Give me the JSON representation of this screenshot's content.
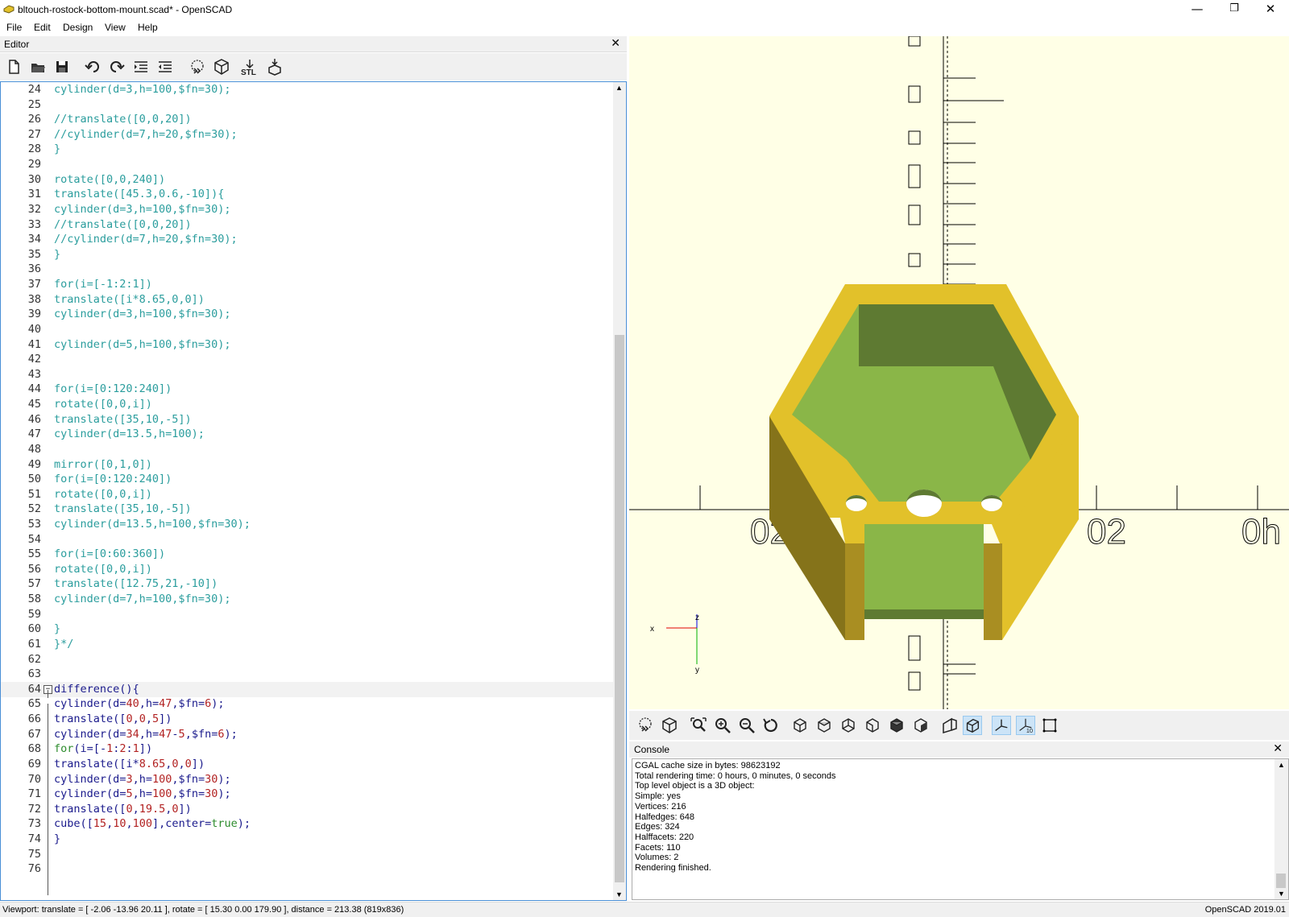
{
  "window": {
    "title": "bltouch-rostock-bottom-mount.scad* - OpenSCAD",
    "minimize": "—",
    "restore": "❐",
    "close": "✕"
  },
  "menu": [
    "File",
    "Edit",
    "Design",
    "View",
    "Help"
  ],
  "editor": {
    "title": "Editor",
    "close": "✕",
    "lines": [
      {
        "n": "24",
        "t": "cylinder(d=3,h=100,$fn=30);"
      },
      {
        "n": "25",
        "t": ""
      },
      {
        "n": "26",
        "t": "//translate([0,0,20])"
      },
      {
        "n": "27",
        "t": "//cylinder(d=7,h=20,$fn=30);"
      },
      {
        "n": "28",
        "t": "}"
      },
      {
        "n": "29",
        "t": ""
      },
      {
        "n": "30",
        "t": "rotate([0,0,240])"
      },
      {
        "n": "31",
        "t": "translate([45.3,0.6,-10]){"
      },
      {
        "n": "32",
        "t": "cylinder(d=3,h=100,$fn=30);"
      },
      {
        "n": "33",
        "t": "//translate([0,0,20])"
      },
      {
        "n": "34",
        "t": "//cylinder(d=7,h=20,$fn=30);"
      },
      {
        "n": "35",
        "t": "}"
      },
      {
        "n": "36",
        "t": ""
      },
      {
        "n": "37",
        "t": "for(i=[-1:2:1])"
      },
      {
        "n": "38",
        "t": "translate([i*8.65,0,0])"
      },
      {
        "n": "39",
        "t": "cylinder(d=3,h=100,$fn=30);"
      },
      {
        "n": "40",
        "t": ""
      },
      {
        "n": "41",
        "t": "cylinder(d=5,h=100,$fn=30);"
      },
      {
        "n": "42",
        "t": ""
      },
      {
        "n": "43",
        "t": ""
      },
      {
        "n": "44",
        "t": "for(i=[0:120:240])"
      },
      {
        "n": "45",
        "t": "rotate([0,0,i])"
      },
      {
        "n": "46",
        "t": "translate([35,10,-5])"
      },
      {
        "n": "47",
        "t": "cylinder(d=13.5,h=100);"
      },
      {
        "n": "48",
        "t": ""
      },
      {
        "n": "49",
        "t": "mirror([0,1,0])"
      },
      {
        "n": "50",
        "t": "for(i=[0:120:240])"
      },
      {
        "n": "51",
        "t": "rotate([0,0,i])"
      },
      {
        "n": "52",
        "t": "translate([35,10,-5])"
      },
      {
        "n": "53",
        "t": "cylinder(d=13.5,h=100,$fn=30);"
      },
      {
        "n": "54",
        "t": ""
      },
      {
        "n": "55",
        "t": "for(i=[0:60:360])"
      },
      {
        "n": "56",
        "t": "rotate([0,0,i])"
      },
      {
        "n": "57",
        "t": "translate([12.75,21,-10])"
      },
      {
        "n": "58",
        "t": "cylinder(d=7,h=100,$fn=30);"
      },
      {
        "n": "59",
        "t": ""
      },
      {
        "n": "60",
        "t": "}"
      },
      {
        "n": "61",
        "t": "}*/"
      },
      {
        "n": "62",
        "t": ""
      },
      {
        "n": "63",
        "t": ""
      }
    ],
    "active_lines": [
      {
        "n": "64",
        "t": "difference(){"
      },
      {
        "n": "65",
        "t": "cylinder(d=40,h=47,$fn=6);"
      },
      {
        "n": "66",
        "t": "translate([0,0,5])"
      },
      {
        "n": "67",
        "t": "cylinder(d=34,h=47-5,$fn=6);"
      },
      {
        "n": "68",
        "t": "for(i=[-1:2:1])"
      },
      {
        "n": "69",
        "t": "translate([i*8.65,0,0])"
      },
      {
        "n": "70",
        "t": "cylinder(d=3,h=100,$fn=30);"
      },
      {
        "n": "71",
        "t": "cylinder(d=5,h=100,$fn=30);"
      },
      {
        "n": "72",
        "t": "translate([0,19.5,0])"
      },
      {
        "n": "73",
        "t": "cube([15,10,100],center=true);"
      },
      {
        "n": "74",
        "t": "}"
      },
      {
        "n": "75",
        "t": ""
      },
      {
        "n": "76",
        "t": ""
      }
    ]
  },
  "viewport": {
    "axis_labels": {
      "x": "x",
      "z": "z",
      "y": "y"
    },
    "ruler_labels_left": "02",
    "ruler_labels_right": "02",
    "ruler_labels_far_right": "0h",
    "colors": {
      "top": "#e2c12a",
      "inner": "#8ab648",
      "inner_dark": "#5e7a32",
      "side": "#85731a",
      "bg": "#ffffe6"
    }
  },
  "console": {
    "title": "Console",
    "close": "✕",
    "lines": [
      "CGAL cache size in bytes: 98623192",
      "Total rendering time: 0 hours, 0 minutes, 0 seconds",
      "Top level object is a 3D object:",
      "Simple:    yes",
      "Vertices:     216",
      "Halfedges:     648",
      "Edges:      324",
      "Halffacets:     220",
      "Facets:      110",
      "Volumes:       2",
      "Rendering finished."
    ]
  },
  "statusbar": {
    "viewport": "Viewport: translate = [ -2.06 -13.96 20.11 ], rotate = [ 15.30 0.00 179.90 ], distance = 213.38 (819x836)",
    "version": "OpenSCAD 2019.01"
  }
}
